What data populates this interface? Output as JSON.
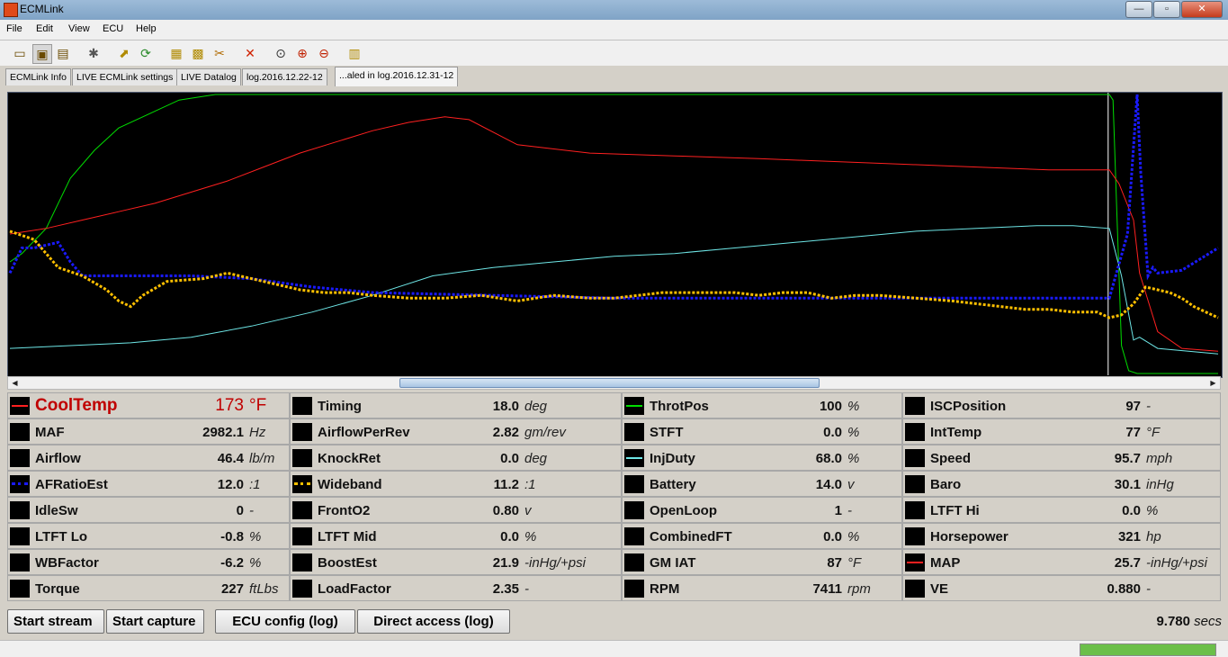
{
  "window": {
    "title": "ECMLink",
    "controls": {
      "minimize": "—",
      "maximize": "▫",
      "close": "✕"
    }
  },
  "menu": [
    "File",
    "Edit",
    "View",
    "ECU",
    "Help"
  ],
  "toolbar_icons": [
    "open-folder-icon",
    "save-icon",
    "open-log-icon",
    "tools-icon",
    "export-icon",
    "refresh-icon",
    "config-icon",
    "map-icon",
    "cut-icon",
    "delete-icon",
    "zoom-reset-icon",
    "zoom-in-icon",
    "zoom-out-icon",
    "chart-icon"
  ],
  "tabs": [
    "ECMLink Info",
    "LIVE ECMLink settings",
    "LIVE Datalog",
    "log.2016.12.22-12",
    "...aled in log.2016.12.31-12"
  ],
  "active_tab": 4,
  "chart_data": {
    "type": "line",
    "xlim": [
      0,
      100
    ],
    "ylim": [
      0,
      100
    ],
    "grid": false,
    "cursor_x": 90.9,
    "series": [
      {
        "name": "ThrotPos",
        "color": "#00dd00",
        "style": "solid",
        "x": [
          0,
          1,
          3,
          5,
          7,
          9,
          12,
          14,
          17,
          91.0,
          91.3,
          91.6,
          92.0,
          92.6,
          93.3,
          100
        ],
        "y": [
          40,
          43,
          52,
          70,
          80,
          88,
          94,
          98,
          100,
          100,
          98,
          60,
          10,
          1,
          0,
          0
        ]
      },
      {
        "name": "CoolTemp",
        "color": "#ff2020",
        "style": "solid",
        "x": [
          0,
          3,
          6,
          9,
          12,
          15,
          18,
          21,
          24,
          27,
          30,
          33,
          36,
          38,
          42,
          48,
          55,
          62,
          68,
          74,
          80,
          86,
          88,
          91,
          91.8,
          93,
          93.5,
          95,
          97,
          100
        ],
        "y": [
          50,
          52,
          55,
          58,
          61,
          65,
          69,
          74,
          79,
          83,
          87,
          90,
          92,
          91,
          82,
          79,
          78,
          77,
          76,
          75,
          74,
          73,
          73,
          73,
          68,
          55,
          36,
          15,
          9,
          8
        ]
      },
      {
        "name": "InjDuty",
        "color": "#6ee6e6",
        "style": "solid",
        "x": [
          0,
          5,
          10,
          15,
          20,
          25,
          30,
          35,
          40,
          45,
          50,
          55,
          60,
          65,
          70,
          75,
          80,
          85,
          88,
          91,
          92,
          93,
          93.5,
          95,
          100
        ],
        "y": [
          9,
          10,
          11,
          13,
          17,
          22,
          28,
          35,
          38,
          40,
          42,
          43,
          45,
          47,
          49,
          51,
          52,
          53,
          53,
          52,
          35,
          12,
          13,
          9,
          7
        ]
      },
      {
        "name": "AFRatioEst",
        "color": "#1a1aff",
        "style": "dotted",
        "x": [
          0,
          1,
          2,
          4,
          5,
          6,
          15,
          20,
          25,
          30,
          40,
          50,
          60,
          70,
          80,
          91,
          92.5,
          93.3,
          93.6,
          94.2,
          94.6,
          95,
          97,
          100
        ],
        "y": [
          36,
          45,
          45,
          47,
          40,
          35,
          35,
          34,
          31,
          29,
          28,
          27,
          27,
          27,
          27,
          27,
          50,
          100,
          72,
          35,
          38,
          36,
          37,
          45
        ]
      },
      {
        "name": "Wideband",
        "color": "#ffc000",
        "style": "dotted",
        "x": [
          0,
          2,
          4,
          6,
          8,
          9,
          10,
          11,
          13,
          16,
          18,
          20,
          22,
          24,
          26,
          28,
          30,
          33,
          36,
          39,
          42,
          45,
          48,
          50,
          52,
          54,
          56,
          58,
          60,
          62,
          64,
          66,
          68,
          70,
          72,
          75,
          78,
          80,
          82,
          84,
          86,
          88,
          90,
          91,
          92,
          93,
          94,
          95,
          96,
          97,
          98,
          100
        ],
        "y": [
          51,
          48,
          38,
          35,
          30,
          26,
          24,
          28,
          33,
          34,
          36,
          34,
          32,
          30,
          29,
          29,
          28,
          27,
          27,
          28,
          26,
          28,
          27,
          27,
          28,
          29,
          29,
          29,
          29,
          28,
          29,
          29,
          27,
          28,
          28,
          27,
          26,
          25,
          24,
          23,
          23,
          22,
          22,
          20,
          21,
          25,
          31,
          30,
          29,
          27,
          24,
          20
        ]
      }
    ]
  },
  "params": [
    {
      "name": "CoolTemp",
      "value": "173",
      "unit": "°F",
      "color": "#ff2020",
      "style": "line",
      "big": true
    },
    {
      "name": "Timing",
      "value": "18.0",
      "unit": "deg"
    },
    {
      "name": "ThrotPos",
      "value": "100",
      "unit": "%",
      "color": "#00dd00",
      "style": "line"
    },
    {
      "name": "ISCPosition",
      "value": "97",
      "unit": "-"
    },
    {
      "name": "MAF",
      "value": "2982.1",
      "unit": "Hz"
    },
    {
      "name": "AirflowPerRev",
      "value": "2.82",
      "unit": "gm/rev"
    },
    {
      "name": "STFT",
      "value": "0.0",
      "unit": "%"
    },
    {
      "name": "IntTemp",
      "value": "77",
      "unit": "°F"
    },
    {
      "name": "Airflow",
      "value": "46.4",
      "unit": "lb/m"
    },
    {
      "name": "KnockRet",
      "value": "0.0",
      "unit": "deg"
    },
    {
      "name": "InjDuty",
      "value": "68.0",
      "unit": "%",
      "color": "#6ee6e6",
      "style": "line"
    },
    {
      "name": "Speed",
      "value": "95.7",
      "unit": "mph"
    },
    {
      "name": "AFRatioEst",
      "value": "12.0",
      "unit": ":1",
      "color": "#1a1aff",
      "style": "dotted"
    },
    {
      "name": "Wideband",
      "value": "11.2",
      "unit": ":1",
      "color": "#ffc000",
      "style": "dotted"
    },
    {
      "name": "Battery",
      "value": "14.0",
      "unit": "v"
    },
    {
      "name": "Baro",
      "value": "30.1",
      "unit": "inHg"
    },
    {
      "name": "IdleSw",
      "value": "0",
      "unit": "-"
    },
    {
      "name": "FrontO2",
      "value": "0.80",
      "unit": "v"
    },
    {
      "name": "OpenLoop",
      "value": "1",
      "unit": "-"
    },
    {
      "name": "LTFT Hi",
      "value": "0.0",
      "unit": "%"
    },
    {
      "name": "LTFT Lo",
      "value": "-0.8",
      "unit": "%"
    },
    {
      "name": "LTFT Mid",
      "value": "0.0",
      "unit": "%"
    },
    {
      "name": "CombinedFT",
      "value": "0.0",
      "unit": "%"
    },
    {
      "name": "Horsepower",
      "value": "321",
      "unit": "hp"
    },
    {
      "name": "WBFactor",
      "value": "-6.2",
      "unit": "%"
    },
    {
      "name": "BoostEst",
      "value": "21.9",
      "unit": "-inHg/+psi"
    },
    {
      "name": "GM IAT",
      "value": "87",
      "unit": "°F"
    },
    {
      "name": "MAP",
      "value": "25.7",
      "unit": "-inHg/+psi",
      "color": "#ff2020",
      "style": "line"
    },
    {
      "name": "Torque",
      "value": "227",
      "unit": "ftLbs"
    },
    {
      "name": "LoadFactor",
      "value": "2.35",
      "unit": "-"
    },
    {
      "name": "RPM",
      "value": "7411",
      "unit": "rpm"
    },
    {
      "name": "VE",
      "value": "0.880",
      "unit": "-"
    }
  ],
  "buttons": {
    "start_stream": "Start stream",
    "start_capture": "Start capture",
    "ecu_config": "ECU config (log)",
    "direct_access": "Direct access (log)"
  },
  "elapsed": {
    "value": "9.780",
    "unit": "secs"
  },
  "status": {
    "progress": 1.0
  }
}
